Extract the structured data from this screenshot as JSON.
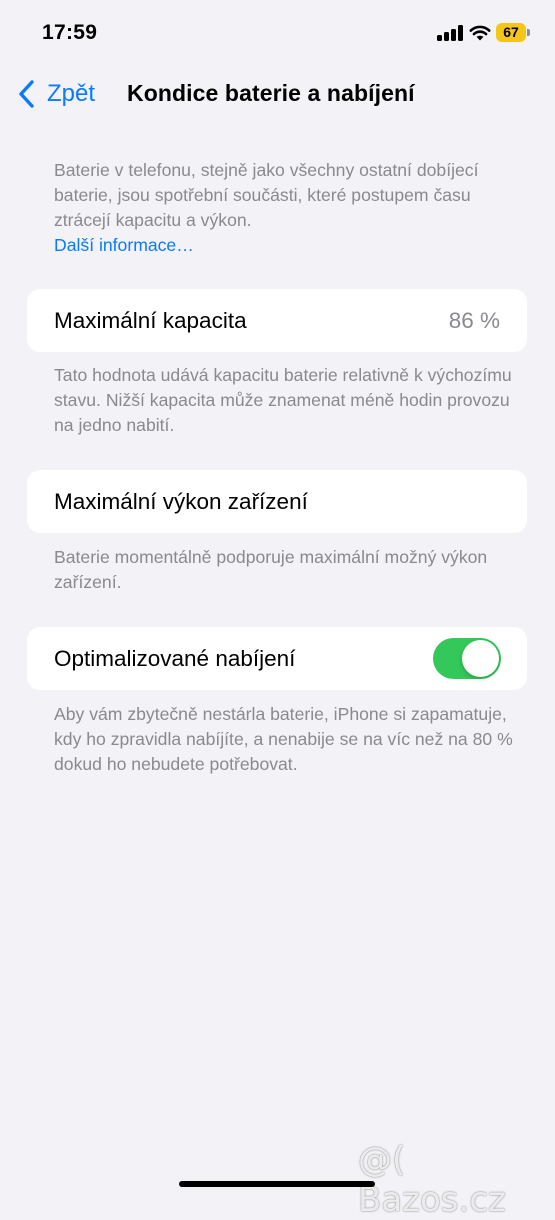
{
  "status_bar": {
    "time": "17:59",
    "battery_level": "67",
    "icons": [
      "signal-icon",
      "wifi-icon",
      "battery-icon"
    ],
    "battery_color": "#f5c518"
  },
  "nav": {
    "back_label": "Zpět",
    "title": "Kondice baterie a nabíjení"
  },
  "intro": {
    "text": "Baterie v telefonu, stejně jako všechny ostatní dobíjecí baterie, jsou spotřební součásti, které postupem času ztrácejí kapacitu a výkon.",
    "link": "Další informace…"
  },
  "max_capacity": {
    "label": "Maximální kapacita",
    "value": "86 %",
    "footer": "Tato hodnota udává kapacitu baterie relativně k výchozímu stavu. Nižší kapacita může znamenat méně hodin provozu na jedno nabití."
  },
  "peak_performance": {
    "label": "Maximální výkon zařízení",
    "footer": "Baterie momentálně podporuje maximální možný výkon zařízení."
  },
  "optimized_charging": {
    "label": "Optimalizované nabíjení",
    "enabled": true,
    "footer": "Aby vám zbytečně nestárla baterie, iPhone si zapamatuje, kdy ho zpravidla nabíjíte, a nenabije se na víc než na 80 % dokud ho nebudete potřebovat."
  },
  "watermark": "@( Bazos.cz",
  "colors": {
    "accent": "#0a7aff",
    "toggle_on": "#34c759",
    "background": "#f2f2f7",
    "secondary_text": "#8a8a8e"
  }
}
